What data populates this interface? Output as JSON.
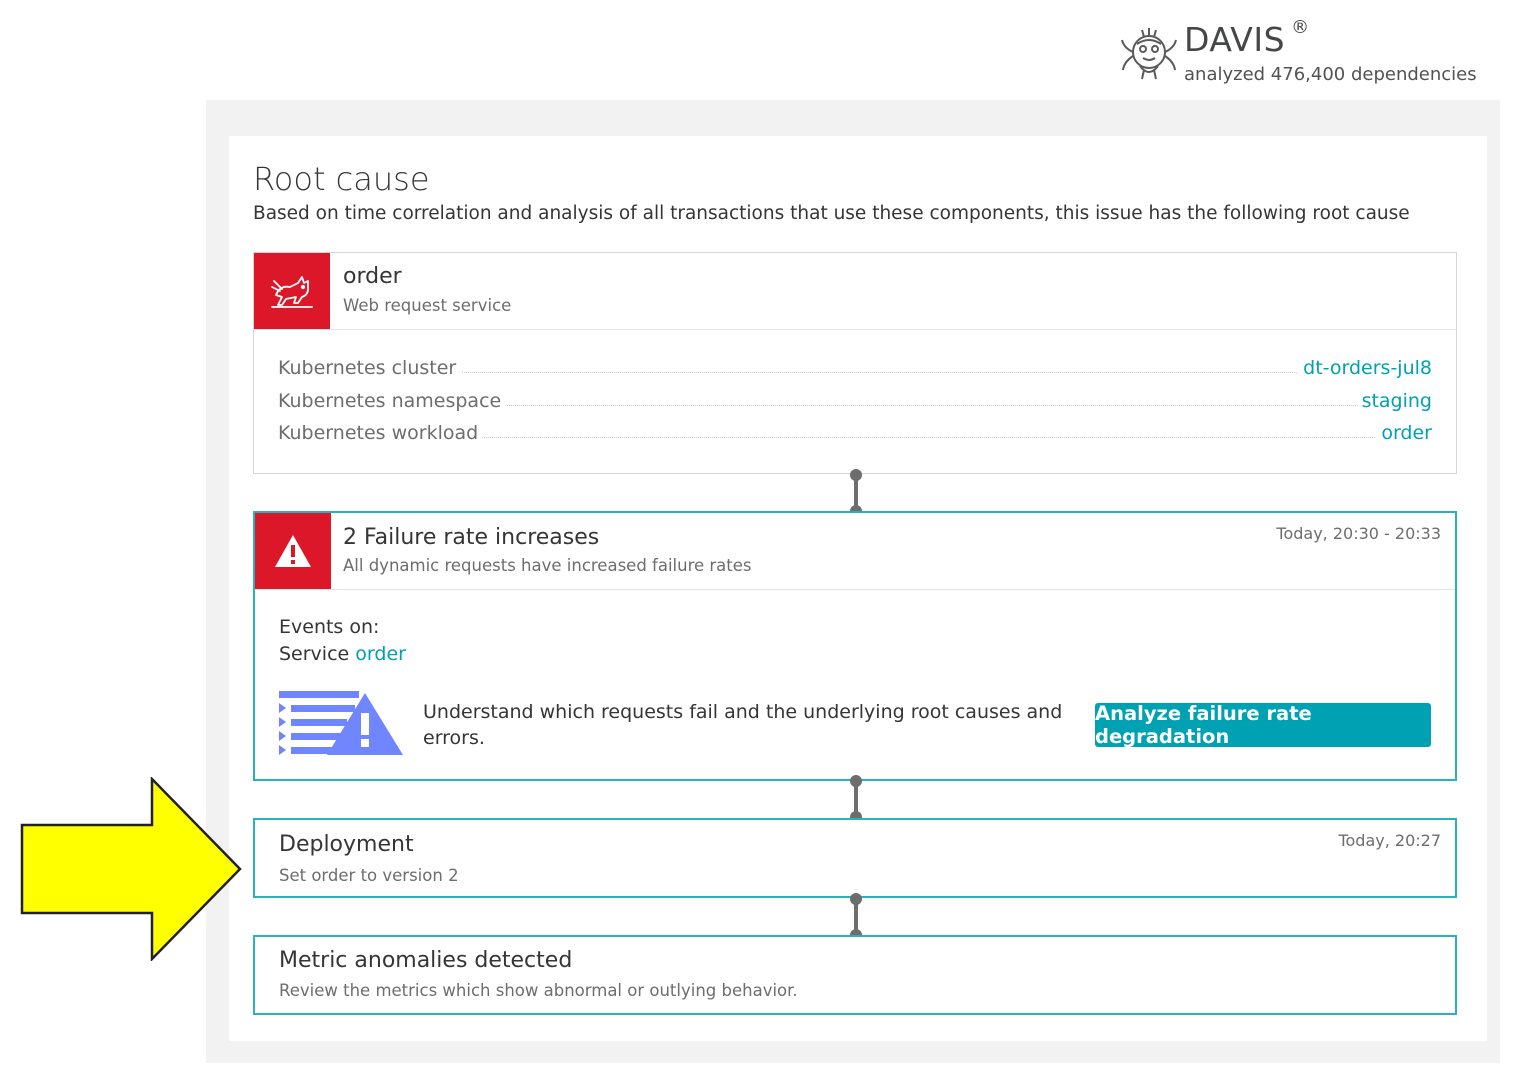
{
  "davis": {
    "name": "DAVIS",
    "reg": "®",
    "subtitle": "analyzed 476,400 dependencies"
  },
  "root_cause": {
    "title": "Root cause",
    "description": "Based on time correlation and analysis of all transactions that use these components, this issue has the following root cause"
  },
  "service_card": {
    "icon": "tomcat-icon",
    "title": "order",
    "subtitle": "Web request service",
    "properties": [
      {
        "key": "Kubernetes cluster",
        "value": "dt-orders-jul8"
      },
      {
        "key": "Kubernetes namespace",
        "value": "staging"
      },
      {
        "key": "Kubernetes workload",
        "value": "order"
      }
    ]
  },
  "failure_card": {
    "icon": "warning-icon",
    "title": "2 Failure rate increases",
    "subtitle": "All dynamic requests have increased failure rates",
    "time": "Today, 20:30 - 20:33",
    "events_label": "Events on:",
    "service_prefix": "Service",
    "service_link": "order",
    "understand_text": "Understand which requests fail and the underlying root causes and errors.",
    "button_label": "Analyze failure rate degradation"
  },
  "deployment_card": {
    "title": "Deployment",
    "subtitle": "Set order to version 2",
    "time": "Today, 20:27"
  },
  "metric_card": {
    "title": "Metric anomalies detected",
    "subtitle": "Review the metrics which show abnormal or outlying behavior."
  },
  "colors": {
    "accent": "#00a1b2",
    "border_teal": "#2ab0bf",
    "danger": "#dc172a",
    "illustration": "#6f86ff",
    "arrow_fill": "#ffff00"
  }
}
